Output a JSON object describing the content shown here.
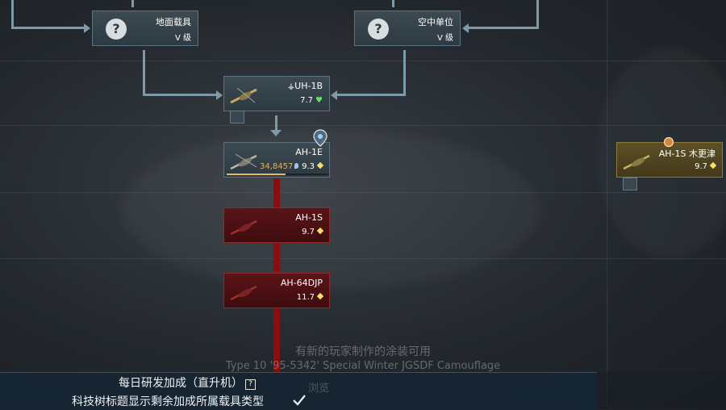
{
  "tree": {
    "ground_vehicles": {
      "name": "地面载具",
      "rank": "V 级"
    },
    "air_units": {
      "name": "空中单位",
      "rank": "V 级"
    },
    "uh1b": {
      "name": "UH-1B",
      "br": "7.7"
    },
    "ah1e": {
      "name": "AH-1E",
      "br": "9.3",
      "rp": "34,8457"
    },
    "ah1s": {
      "name": "AH-1S",
      "br": "9.7"
    },
    "ah64djp": {
      "name": "AH-64DJP",
      "br": "11.7"
    },
    "ah1s_kisarazu": {
      "name": "AH-1S 木更津",
      "br": "9.7"
    }
  },
  "notice": {
    "line1": "有新的玩家制作的涂装可用",
    "line2": "Type 10 '95-5342' Special Winter JGSDF Camouflage",
    "line3": "浏览"
  },
  "bottom": {
    "daily_bonus": "每日研发加成（直升机）",
    "help_mark": "?",
    "show_types": "科技树标题显示剩余加成所属载具类型",
    "checkbox_checked": true
  },
  "colors": {
    "accent_locked": "#8a0d10",
    "premium": "#e0b86a"
  },
  "icons": [
    "question-icon",
    "helicopter-icon",
    "heart-icon",
    "br-diamond-icon",
    "check-icon",
    "marker-icon"
  ]
}
